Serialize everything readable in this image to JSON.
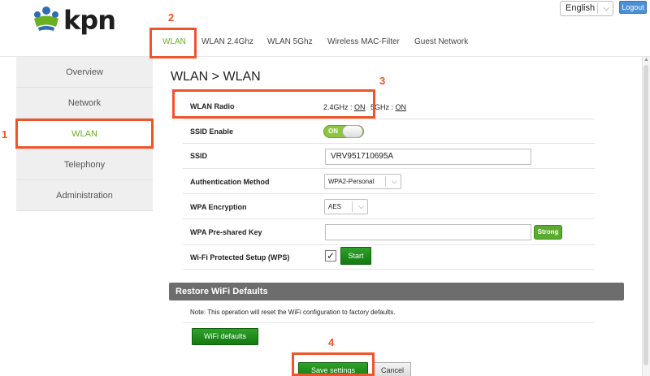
{
  "brand": {
    "logo_text": "kpn",
    "accent_color": "#6ab023",
    "annotation_color": "#f0542a"
  },
  "header": {
    "language": {
      "selected": "English"
    },
    "logout_label": "Logout"
  },
  "top_tabs": [
    {
      "label": "WLAN",
      "active": true
    },
    {
      "label": "WLAN 2.4Ghz"
    },
    {
      "label": "WLAN 5Ghz"
    },
    {
      "label": "Wireless MAC-Filter"
    },
    {
      "label": "Guest Network"
    }
  ],
  "sidebar": {
    "items": [
      {
        "label": "Overview"
      },
      {
        "label": "Network"
      },
      {
        "label": "WLAN",
        "active": true
      },
      {
        "label": "Telephony"
      },
      {
        "label": "Administration"
      }
    ]
  },
  "page": {
    "title": "WLAN > WLAN"
  },
  "form": {
    "wlan_radio": {
      "label": "WLAN Radio",
      "band_24_prefix": "2.4GHz : ",
      "band_24_value": "ON",
      "band_5_prefix": "5GHz : ",
      "band_5_value": "ON"
    },
    "ssid_enable": {
      "label": "SSID Enable",
      "toggle_text": "ON"
    },
    "ssid": {
      "label": "SSID",
      "value": "VRV951710695A"
    },
    "auth_method": {
      "label": "Authentication Method",
      "selected": "WPA2-Personal"
    },
    "wpa_encryption": {
      "label": "WPA Encryption",
      "selected": "AES"
    },
    "psk": {
      "label": "WPA Pre-shared Key",
      "value": "",
      "strength": "Strong"
    },
    "wps": {
      "label": "Wi-Fi Protected Setup (WPS)",
      "checked": true,
      "start_label": "Start"
    }
  },
  "restore": {
    "title": "Restore WiFi Defaults",
    "note": "Note: This operation will reset the WiFi configuration to factory defaults.",
    "button_label": "WiFi defaults"
  },
  "footer": {
    "save_label": "Save settings",
    "cancel_label": "Cancel"
  },
  "annotations": [
    {
      "number": "1"
    },
    {
      "number": "2"
    },
    {
      "number": "3"
    },
    {
      "number": "4"
    }
  ]
}
